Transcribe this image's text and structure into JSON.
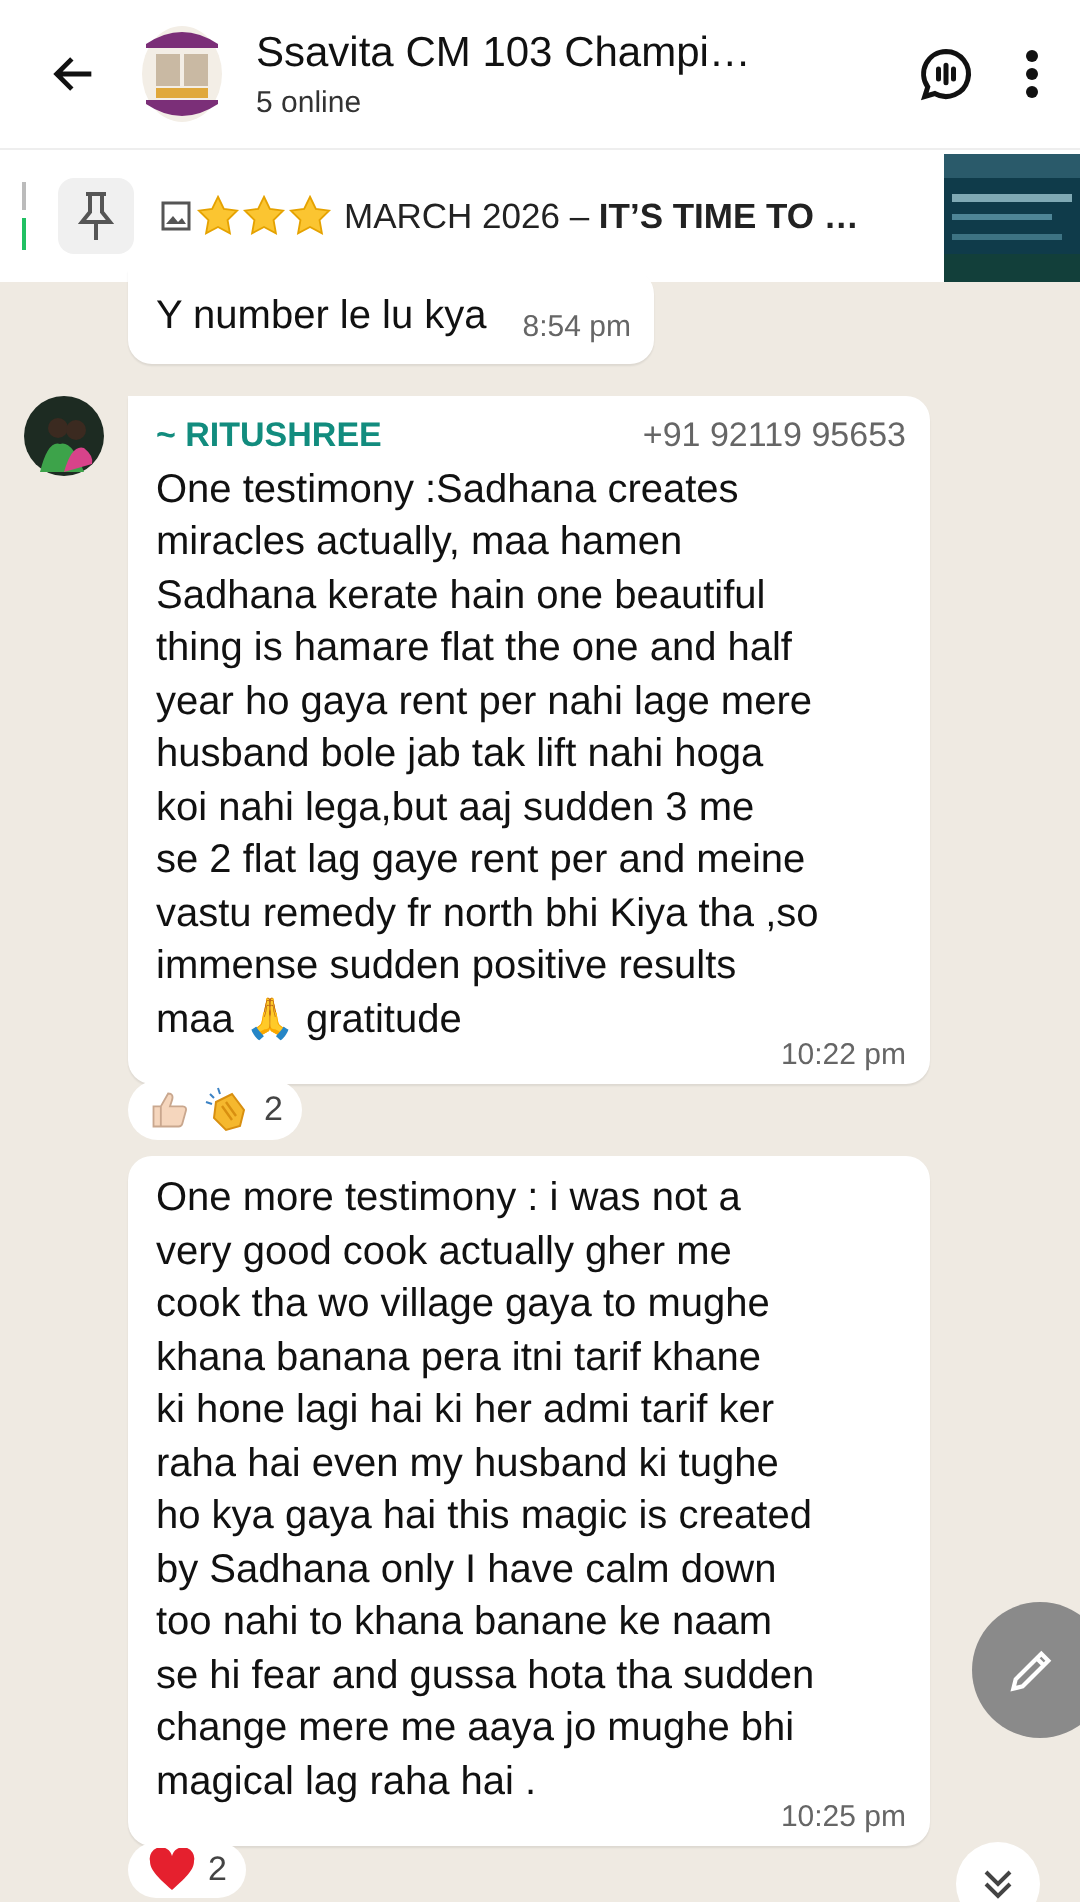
{
  "header": {
    "title": "Ssavita CM 103 Champi…",
    "subtitle": "5 online"
  },
  "pinned": {
    "prefix": "MARCH 2026 – ",
    "bold": "IT’S TIME TO …"
  },
  "messages": [
    {
      "kind": "own-tail",
      "text": "Y number le lu kya",
      "time": "8:54 pm"
    },
    {
      "kind": "sender",
      "sender": "~ RITUSHREE",
      "phone": "+91 92119 95653",
      "text": "One testimony :Sadhana creates\nmiracles actually, maa hamen\nSadhana kerate hain one beautiful\nthing is hamare flat the one and half\nyear ho gaya rent per nahi lage mere\nhusband bole jab tak lift nahi hoga\nkoi nahi lega,but aaj sudden 3 me\nse 2 flat lag gaye rent per and meine\nvastu remedy fr north bhi Kiya tha ,so\nimmense sudden positive results\nmaa 🙏 gratitude",
      "time": "10:22 pm",
      "reactions": [
        {
          "kind": "thumbs-up"
        },
        {
          "kind": "clap"
        }
      ],
      "reaction_count": "2"
    },
    {
      "kind": "continued",
      "text": "One more testimony : i was not a\nvery good cook actually gher me\ncook tha wo village gaya to mughe\nkhana banana pera itni tarif khane\nki hone lagi hai ki her admi tarif ker\nraha hai even my husband ki tughe\nho kya gaya hai this magic is created\nby Sadhana only I have calm down\ntoo nahi to khana banane ke naam\nse hi fear and gussa hota tha sudden\nchange mere me aaya jo mughe bhi\nmagical lag raha hai .",
      "time": "10:25 pm",
      "reactions": [
        {
          "kind": "heart"
        }
      ],
      "reaction_count": "2"
    }
  ]
}
